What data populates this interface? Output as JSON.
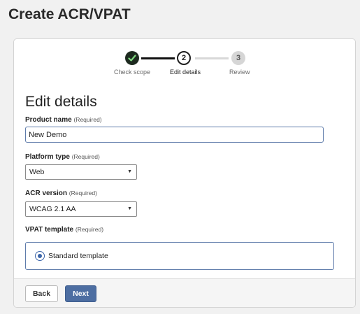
{
  "page": {
    "title": "Create ACR/VPAT"
  },
  "stepper": {
    "steps": [
      {
        "label": "Check scope",
        "status": "complete"
      },
      {
        "label": "Edit details",
        "number": "2",
        "status": "current"
      },
      {
        "label": "Review",
        "number": "3",
        "status": "upcoming"
      }
    ]
  },
  "form": {
    "section_title": "Edit details",
    "required_hint": "(Required)",
    "product_name": {
      "label": "Product name",
      "value": "New Demo"
    },
    "platform_type": {
      "label": "Platform type",
      "selected": "Web"
    },
    "acr_version": {
      "label": "ACR version",
      "selected": "WCAG 2.1 AA"
    },
    "vpat_template": {
      "label": "VPAT template",
      "option": "Standard template",
      "checked": true
    }
  },
  "footer": {
    "back_label": "Back",
    "next_label": "Next"
  },
  "colors": {
    "accent": "#4d6ea2",
    "focus_border": "#5f7cab",
    "complete_step": "#1d2a1f"
  }
}
